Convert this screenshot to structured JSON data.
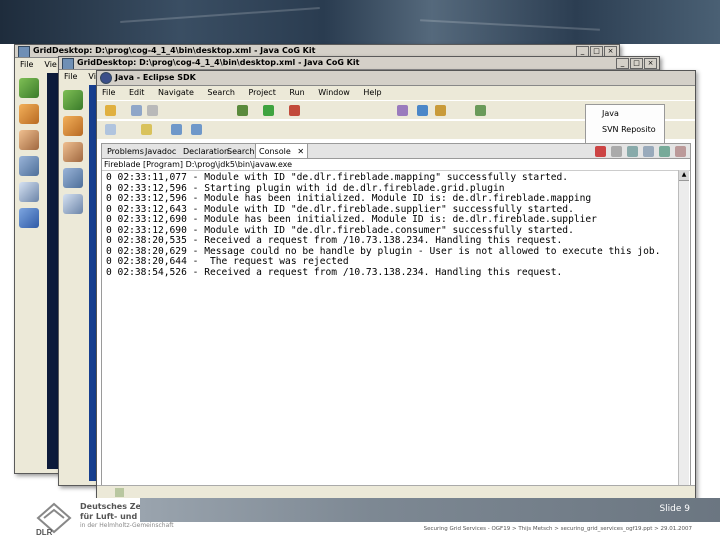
{
  "window_back": {
    "title": "GridDesktop: D:\\prog\\cog-4_1_4\\bin\\desktop.xml - Java CoG Kit",
    "menu": [
      "File",
      "Vie"
    ]
  },
  "window_mid": {
    "title": "GridDesktop: D:\\prog\\cog-4_1_4\\bin\\desktop.xml - Java CoG Kit",
    "menu": [
      "File",
      "Vie"
    ]
  },
  "eclipse": {
    "title": "Java - Eclipse SDK",
    "menu": [
      "File",
      "Edit",
      "Navigate",
      "Search",
      "Project",
      "Run",
      "Window",
      "Help"
    ],
    "perspectives": [
      "Java",
      "SVN Reposito"
    ],
    "tabs": [
      "Problems",
      "Javadoc",
      "Declaration",
      "Search",
      "Console"
    ],
    "active_tab": "Console",
    "console_header": "Fireblade [Program] D:\\prog\\jdk5\\bin\\javaw.exe",
    "console_lines": [
      "0 02:33:11,077 - Module with ID \"de.dlr.fireblade.mapping\" successfully started.",
      "0 02:33:12,596 - Starting plugin with id de.dlr.fireblade.grid.plugin",
      "0 02:33:12,596 - Module has been initialized. Module ID is: de.dlr.fireblade.mapping",
      "0 02:33:12,643 - Module with ID \"de.dlr.fireblade.supplier\" successfully started.",
      "0 02:33:12,690 - Module has been initialized. Module ID is: de.dlr.fireblade.supplier",
      "0 02:33:12,690 - Module with ID \"de.dlr.fireblade.consumer\" successfully started.",
      "0 02:38:20,535 - Received a request from /10.73.138.234. Handling this request.",
      "0 02:38:20,629 - Message could no be handle by plugin - User is not allowed to execute this job.",
      "0 02:38:20,644 -  The request was rejected",
      "0 02:38:54,526 - Received a request from /10.73.138.234. Handling this request."
    ]
  },
  "footer": {
    "org_line1": "Deutsches Zentrum",
    "org_line2": "für Luft- und Raumfahrt e.V.",
    "org_line3": "in der Helmholtz-Gemeinschaft",
    "logo_text": "DLR",
    "slide": "Slide 9",
    "caption": "Securing Grid Services - OGF19 > Thijs Metsch > securing_grid_services_ogf19.ppt > 29.01.2007"
  }
}
